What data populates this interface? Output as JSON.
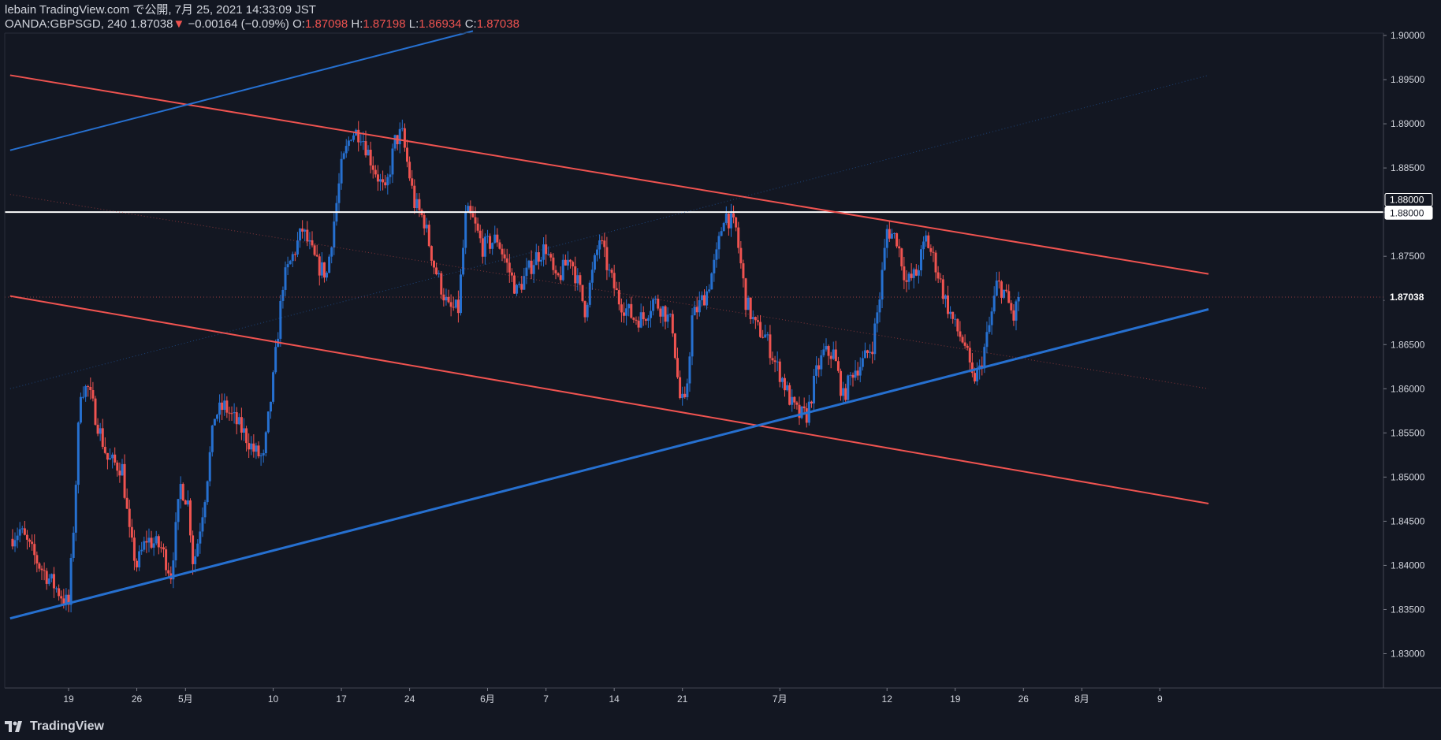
{
  "header": {
    "publisher_line": "lebain TradingView.com で公開, 7月 25, 2021 14:33:09 JST",
    "symbol_interval": "OANDA:GBPSGD, 240",
    "last_price": "1.87038",
    "change_arrow": "▼",
    "change_text": "−0.00164 (−0.09%)",
    "o_label": "O:",
    "o_value": "1.87098",
    "h_label": "H:",
    "h_value": "1.87198",
    "l_label": "L:",
    "l_value": "1.86934",
    "c_label": "C:",
    "c_value": "1.87038"
  },
  "footer": {
    "brand": "TradingView"
  },
  "colors": {
    "background": "#131722",
    "up": "#2670d0",
    "down": "#ef5350",
    "text": "#d1d4dc",
    "grid": "#2a2e39"
  },
  "chart_data": {
    "type": "candlestick",
    "symbol": "OANDA:GBPSGD",
    "interval": "240",
    "ylim": [
      1.825,
      1.9
    ],
    "price_axis_ticks": [
      "1.90000",
      "1.89500",
      "1.89000",
      "1.88500",
      "1.88000",
      "1.87500",
      "1.87000",
      "1.86500",
      "1.86000",
      "1.85500",
      "1.85000",
      "1.84500",
      "1.84000",
      "1.83500",
      "1.83000"
    ],
    "time_axis_ticks": [
      {
        "label": "19",
        "day": 0
      },
      {
        "label": "26",
        "day": 7
      },
      {
        "label": "5月",
        "day": 12
      },
      {
        "label": "10",
        "day": 21
      },
      {
        "label": "17",
        "day": 28
      },
      {
        "label": "24",
        "day": 35
      },
      {
        "label": "6月",
        "day": 43
      },
      {
        "label": "7",
        "day": 49
      },
      {
        "label": "14",
        "day": 56
      },
      {
        "label": "21",
        "day": 63
      },
      {
        "label": "7月",
        "day": 73
      },
      {
        "label": "12",
        "day": 84
      },
      {
        "label": "19",
        "day": 91
      },
      {
        "label": "26",
        "day": 98
      },
      {
        "label": "8月",
        "day": 104
      },
      {
        "label": "9",
        "day": 112
      }
    ],
    "price_labels": [
      {
        "text": "1.88000",
        "value": 1.8814,
        "style": "outline"
      },
      {
        "text": "1.88000",
        "value": 1.8799,
        "style": "filled"
      },
      {
        "text": "1.87038",
        "value": 1.87038,
        "style": "current"
      }
    ],
    "horizontal_line": {
      "value": 1.88,
      "color": "#ffffff"
    },
    "trend_lines": [
      {
        "name": "upper-red-channel",
        "color": "#ef5350",
        "width": 2,
        "from": {
          "day": -6,
          "price": 1.8955
        },
        "to": {
          "day": 117,
          "price": 1.873
        }
      },
      {
        "name": "lower-red-channel",
        "color": "#ef5350",
        "width": 2,
        "from": {
          "day": -6,
          "price": 1.8705
        },
        "to": {
          "day": 117,
          "price": 1.847
        }
      },
      {
        "name": "red-midline",
        "color": "#ef5350",
        "width": 1,
        "dotted": true,
        "from": {
          "day": -6,
          "price": 1.882
        },
        "to": {
          "day": 117,
          "price": 1.86
        }
      },
      {
        "name": "blue-support",
        "color": "#2670d0",
        "width": 3,
        "from": {
          "day": -6,
          "price": 1.834
        },
        "to": {
          "day": 117,
          "price": 1.869
        }
      },
      {
        "name": "blue-upper",
        "color": "#2670d0",
        "width": 2,
        "from": {
          "day": -6,
          "price": 1.887
        },
        "to": {
          "day": 41.5,
          "price": 1.9005
        }
      },
      {
        "name": "blue-faint",
        "color": "#2670d0",
        "width": 1,
        "dotted": true,
        "from": {
          "day": -6,
          "price": 1.86
        },
        "to": {
          "day": 117,
          "price": 1.8955
        }
      }
    ],
    "anchors": [
      {
        "day": -6,
        "price": 1.843
      },
      {
        "day": -5,
        "price": 1.844
      },
      {
        "day": -3,
        "price": 1.84
      },
      {
        "day": -1,
        "price": 1.837
      },
      {
        "day": 0,
        "price": 1.8355
      },
      {
        "day": 0.6,
        "price": 1.846
      },
      {
        "day": 1.2,
        "price": 1.86
      },
      {
        "day": 2,
        "price": 1.86
      },
      {
        "day": 3,
        "price": 1.856
      },
      {
        "day": 4,
        "price": 1.852
      },
      {
        "day": 5.5,
        "price": 1.851
      },
      {
        "day": 6.3,
        "price": 1.843
      },
      {
        "day": 7,
        "price": 1.84
      },
      {
        "day": 8,
        "price": 1.843
      },
      {
        "day": 9.5,
        "price": 1.842
      },
      {
        "day": 10.5,
        "price": 1.839
      },
      {
        "day": 11.5,
        "price": 1.849
      },
      {
        "day": 12.3,
        "price": 1.847
      },
      {
        "day": 12.8,
        "price": 1.84
      },
      {
        "day": 13.3,
        "price": 1.843
      },
      {
        "day": 14,
        "price": 1.848
      },
      {
        "day": 15,
        "price": 1.857
      },
      {
        "day": 16,
        "price": 1.858
      },
      {
        "day": 18,
        "price": 1.855
      },
      {
        "day": 19,
        "price": 1.853
      },
      {
        "day": 20,
        "price": 1.852
      },
      {
        "day": 21,
        "price": 1.861
      },
      {
        "day": 22,
        "price": 1.872
      },
      {
        "day": 24,
        "price": 1.878
      },
      {
        "day": 25.5,
        "price": 1.874
      },
      {
        "day": 26.5,
        "price": 1.873
      },
      {
        "day": 27,
        "price": 1.877
      },
      {
        "day": 28,
        "price": 1.885
      },
      {
        "day": 29,
        "price": 1.889
      },
      {
        "day": 30,
        "price": 1.889
      },
      {
        "day": 31,
        "price": 1.886
      },
      {
        "day": 32.5,
        "price": 1.882
      },
      {
        "day": 33.5,
        "price": 1.888
      },
      {
        "day": 34.2,
        "price": 1.889
      },
      {
        "day": 35.5,
        "price": 1.881
      },
      {
        "day": 36.5,
        "price": 1.879
      },
      {
        "day": 37.5,
        "price": 1.874
      },
      {
        "day": 39,
        "price": 1.869
      },
      {
        "day": 40,
        "price": 1.869
      },
      {
        "day": 40.8,
        "price": 1.88
      },
      {
        "day": 41.5,
        "price": 1.879
      },
      {
        "day": 42.5,
        "price": 1.876
      },
      {
        "day": 44,
        "price": 1.877
      },
      {
        "day": 46,
        "price": 1.871
      },
      {
        "day": 48,
        "price": 1.875
      },
      {
        "day": 49,
        "price": 1.876
      },
      {
        "day": 50,
        "price": 1.872
      },
      {
        "day": 51.5,
        "price": 1.875
      },
      {
        "day": 53,
        "price": 1.869
      },
      {
        "day": 54.5,
        "price": 1.877
      },
      {
        "day": 55.5,
        "price": 1.873
      },
      {
        "day": 56.5,
        "price": 1.87
      },
      {
        "day": 58,
        "price": 1.868
      },
      {
        "day": 59,
        "price": 1.868
      },
      {
        "day": 60,
        "price": 1.87
      },
      {
        "day": 61,
        "price": 1.869
      },
      {
        "day": 62,
        "price": 1.867
      },
      {
        "day": 62.7,
        "price": 1.859
      },
      {
        "day": 63.3,
        "price": 1.858
      },
      {
        "day": 64,
        "price": 1.868
      },
      {
        "day": 65.5,
        "price": 1.871
      },
      {
        "day": 66.5,
        "price": 1.875
      },
      {
        "day": 67.3,
        "price": 1.88
      },
      {
        "day": 68.5,
        "price": 1.878
      },
      {
        "day": 69.5,
        "price": 1.87
      },
      {
        "day": 70.5,
        "price": 1.867
      },
      {
        "day": 71.5,
        "price": 1.866
      },
      {
        "day": 72.5,
        "price": 1.863
      },
      {
        "day": 73.3,
        "price": 1.861
      },
      {
        "day": 74.3,
        "price": 1.858
      },
      {
        "day": 75,
        "price": 1.857
      },
      {
        "day": 75.8,
        "price": 1.857
      },
      {
        "day": 76.8,
        "price": 1.862
      },
      {
        "day": 77.5,
        "price": 1.864
      },
      {
        "day": 78.5,
        "price": 1.864
      },
      {
        "day": 79.5,
        "price": 1.859
      },
      {
        "day": 80.5,
        "price": 1.862
      },
      {
        "day": 81.5,
        "price": 1.863
      },
      {
        "day": 82.5,
        "price": 1.865
      },
      {
        "day": 83.2,
        "price": 1.87
      },
      {
        "day": 84,
        "price": 1.878
      },
      {
        "day": 85,
        "price": 1.877
      },
      {
        "day": 86,
        "price": 1.872
      },
      {
        "day": 87,
        "price": 1.873
      },
      {
        "day": 88,
        "price": 1.877
      },
      {
        "day": 89,
        "price": 1.874
      },
      {
        "day": 90,
        "price": 1.87
      },
      {
        "day": 91,
        "price": 1.867
      },
      {
        "day": 92,
        "price": 1.865
      },
      {
        "day": 92.7,
        "price": 1.861
      },
      {
        "day": 93.5,
        "price": 1.862
      },
      {
        "day": 94.5,
        "price": 1.867
      },
      {
        "day": 95.3,
        "price": 1.872
      },
      {
        "day": 96,
        "price": 1.871
      },
      {
        "day": 97,
        "price": 1.868
      },
      {
        "day": 97.5,
        "price": 1.8704
      }
    ]
  }
}
